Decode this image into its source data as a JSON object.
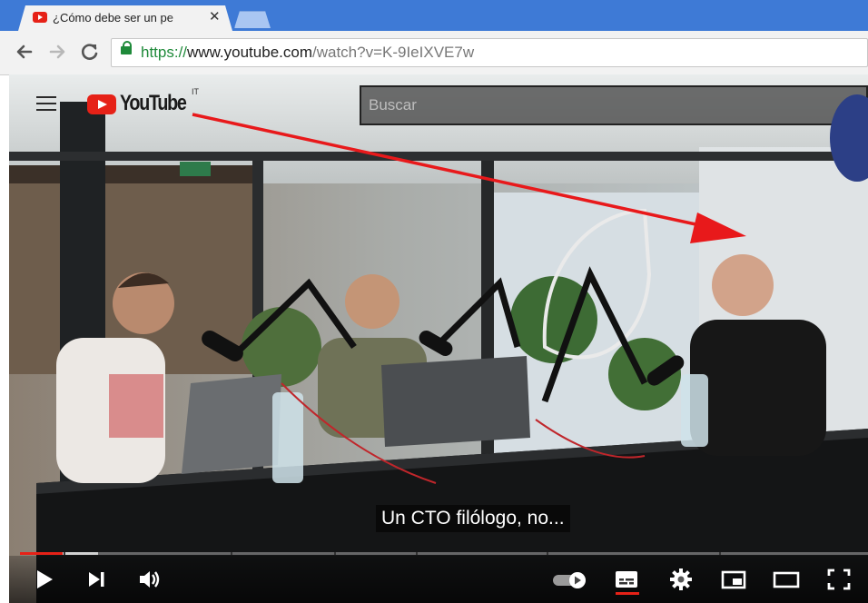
{
  "browser": {
    "tab_title": "¿Cómo debe ser un pe",
    "tab_close": "✕",
    "url": {
      "scheme": "https://",
      "host": "www.youtube.com",
      "path": "/watch?v=K-9IeIXVE7w"
    }
  },
  "youtube": {
    "logo_text": "YouTube",
    "country": "IT",
    "search_placeholder": "Buscar"
  },
  "video": {
    "subtitle": "Un CTO filólogo, no...",
    "progress": {
      "played_fraction": 0.05,
      "buffered_fraction": 0.092
    }
  },
  "colors": {
    "youtube_red": "#e62117",
    "chrome_blue": "#3e7ad6",
    "annotation_arrow": "#e8191b"
  },
  "icons": {
    "controls": [
      "play-icon",
      "next-icon",
      "volume-icon",
      "autoplay-toggle-icon",
      "subtitles-icon",
      "settings-gear-icon",
      "miniplayer-icon",
      "theater-mode-icon",
      "fullscreen-icon"
    ]
  }
}
